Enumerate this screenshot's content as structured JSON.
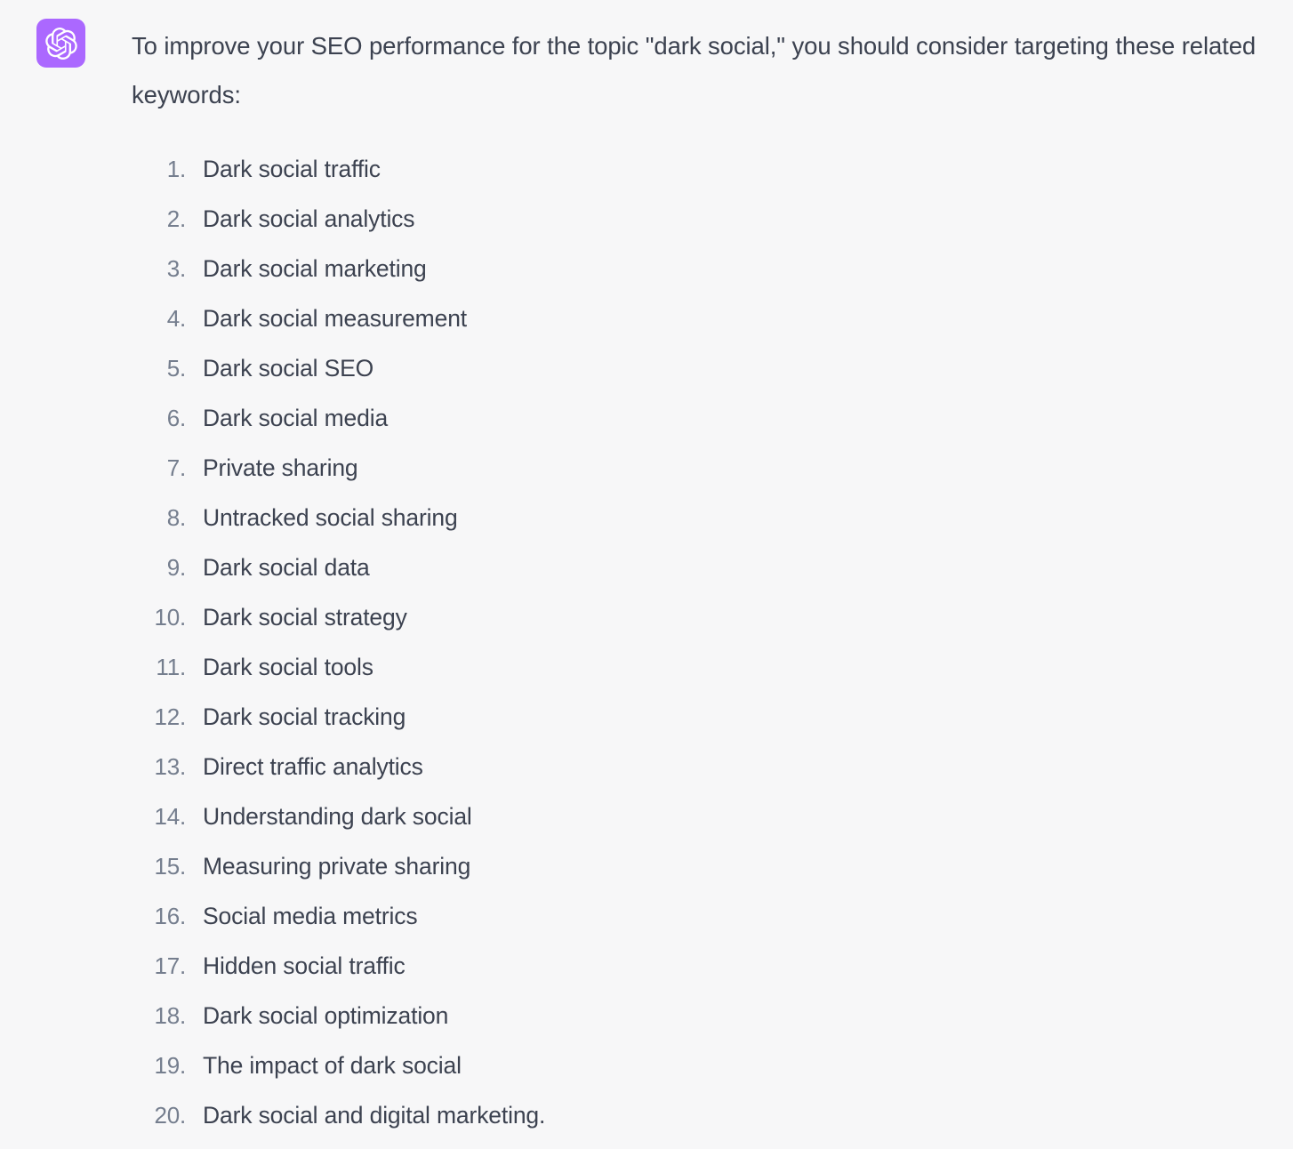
{
  "message": {
    "avatar_icon": "openai-logo-icon",
    "avatar_color": "#AB68FF",
    "intro": "To improve your SEO performance for the topic \"dark social,\" you should consider targeting these related keywords:",
    "text_color": "#3C4250",
    "number_color": "#757E8E",
    "background_color": "#F7F7F8",
    "keywords": [
      {
        "num": "1.",
        "label": "Dark social traffic"
      },
      {
        "num": "2.",
        "label": "Dark social analytics"
      },
      {
        "num": "3.",
        "label": "Dark social marketing"
      },
      {
        "num": "4.",
        "label": "Dark social measurement"
      },
      {
        "num": "5.",
        "label": "Dark social SEO"
      },
      {
        "num": "6.",
        "label": "Dark social media"
      },
      {
        "num": "7.",
        "label": "Private sharing"
      },
      {
        "num": "8.",
        "label": "Untracked social sharing"
      },
      {
        "num": "9.",
        "label": "Dark social data"
      },
      {
        "num": "10.",
        "label": "Dark social strategy"
      },
      {
        "num": "11.",
        "label": "Dark social tools"
      },
      {
        "num": "12.",
        "label": "Dark social tracking"
      },
      {
        "num": "13.",
        "label": "Direct traffic analytics"
      },
      {
        "num": "14.",
        "label": "Understanding dark social"
      },
      {
        "num": "15.",
        "label": "Measuring private sharing"
      },
      {
        "num": "16.",
        "label": "Social media metrics"
      },
      {
        "num": "17.",
        "label": "Hidden social traffic"
      },
      {
        "num": "18.",
        "label": "Dark social optimization"
      },
      {
        "num": "19.",
        "label": "The impact of dark social"
      },
      {
        "num": "20.",
        "label": "Dark social and digital marketing."
      }
    ]
  }
}
